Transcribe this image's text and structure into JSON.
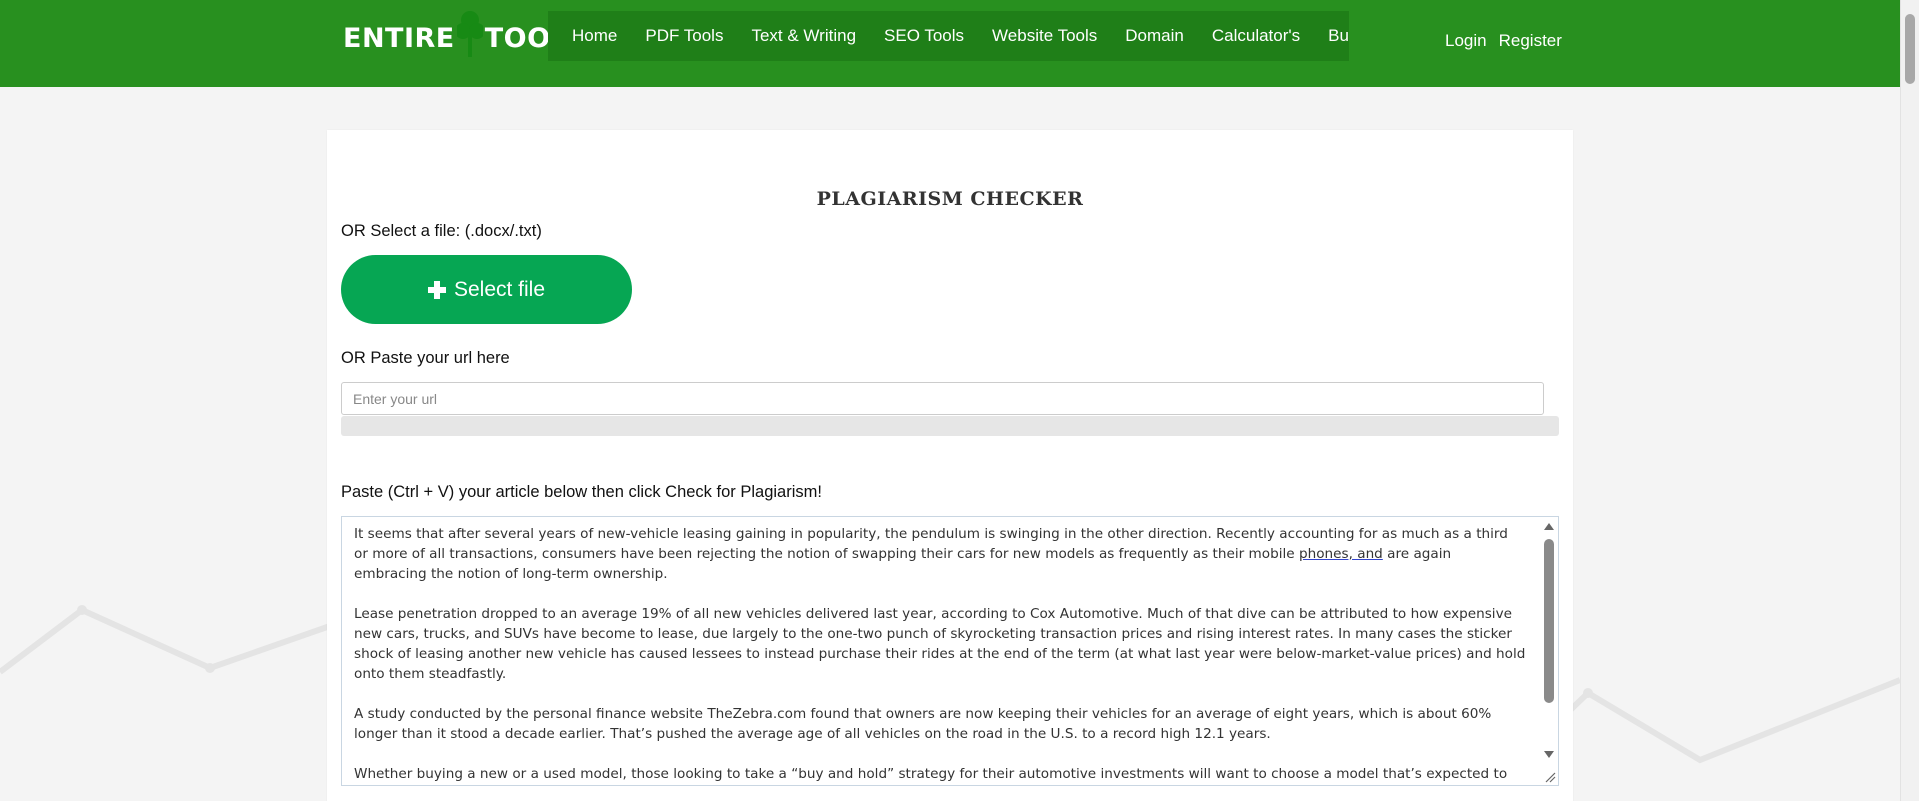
{
  "brand": {
    "logo_left": "ENTIRE",
    "logo_right": "TOOLS",
    "header_color": "#28901f",
    "nav_color": "#1f7f18",
    "button_color": "#06a653"
  },
  "nav": {
    "items": [
      {
        "label": "Home"
      },
      {
        "label": "PDF Tools"
      },
      {
        "label": "Text & Writing"
      },
      {
        "label": "SEO Tools"
      },
      {
        "label": "Website Tools"
      },
      {
        "label": "Domain"
      },
      {
        "label": "Calculator's"
      },
      {
        "label": "Business"
      }
    ]
  },
  "auth": {
    "login": "Login",
    "register": "Register"
  },
  "main": {
    "title": "PLAGIARISM CHECKER",
    "file_label": "OR Select a file: (.docx/.txt)",
    "select_file_button": "Select file",
    "url_label": "OR Paste your url here",
    "url_placeholder": "Enter your url",
    "url_value": "",
    "article_label": "Paste (Ctrl + V) your article below then click Check for Plagiarism!",
    "article": {
      "p1_a": "It seems that after several years of new-vehicle leasing gaining in popularity, the pendulum is swinging in the other direction. Recently accounting for as much as a third or more of all transactions, consumers have been rejecting the notion of swapping their cars for new models as frequently as their mobile ",
      "p1_spell": "phones, and",
      "p1_b": " are again embracing the notion of long-term ownership.",
      "p2": "Lease penetration dropped to an average 19% of all new vehicles delivered last year, according to Cox Automotive. Much of that dive can be attributed to how expensive new cars, trucks, and SUVs have become to lease, due largely to the one-two punch of skyrocketing transaction prices and rising interest rates. In many cases the sticker shock of leasing another new vehicle has caused lessees to instead purchase their rides at the end of the term (at what last year were below-market-value prices) and hold onto them steadfastly.",
      "p3": "A study conducted by the personal finance website TheZebra.com found that owners are now keeping their vehicles for an average of eight years, which is about 60% longer than it stood a decade earlier. That’s pushed the average age of all vehicles on the road in the U.S. to a record high 12.1 years.",
      "p4": "Whether buying a new or a used model, those looking to take a “buy and hold” strategy for their automotive investments will want to choose a model that’s expected to go the distance without breaking the bank in terms of ongoing upkeep and repairs."
    }
  },
  "icons": {
    "logo": "clover-icon",
    "select_file": "plus-icon",
    "scroll_up": "scroll-up-arrow-icon",
    "scroll_down": "scroll-down-arrow-icon",
    "resize": "resize-handle-icon"
  }
}
